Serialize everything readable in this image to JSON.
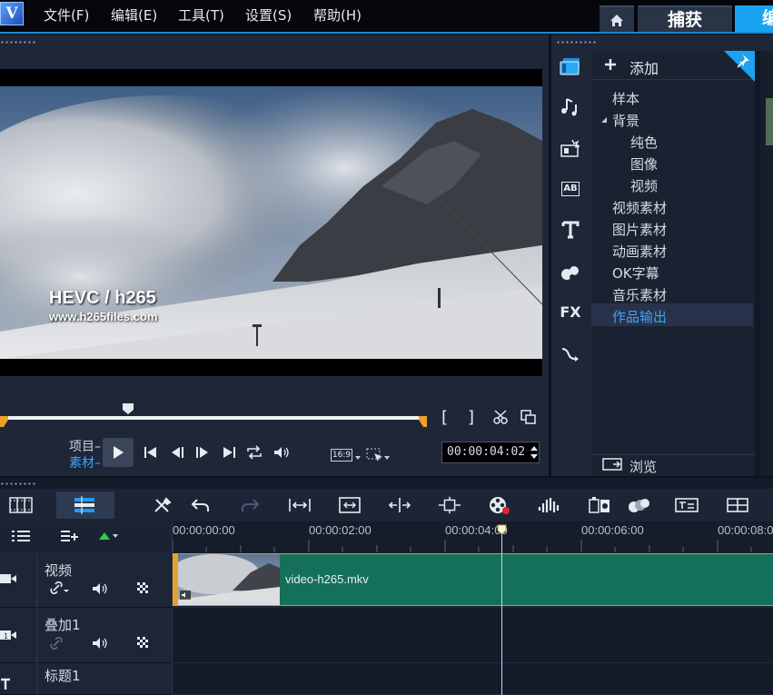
{
  "app": {
    "logo_letter": "V"
  },
  "menu": {
    "items": [
      "文件(F)",
      "编辑(E)",
      "工具(T)",
      "设置(S)",
      "帮助(H)"
    ]
  },
  "workspace_tabs": {
    "capture": "捕获",
    "edit": "编"
  },
  "preview": {
    "overlay_title": "HEVC / h265",
    "overlay_url": "www.h265files.com",
    "mode_project": "项目",
    "mode_clip": "素材",
    "aspect_ratio": "16:9",
    "timecode": "00:00:04:02",
    "in_bracket": "[",
    "out_bracket": "]"
  },
  "library": {
    "add_label": "添加",
    "items": [
      {
        "label": "样本",
        "level": 0
      },
      {
        "label": "背景",
        "level": 0,
        "expanded": true
      },
      {
        "label": "纯色",
        "level": 1
      },
      {
        "label": "图像",
        "level": 1
      },
      {
        "label": "视频",
        "level": 1
      },
      {
        "label": "视频素材",
        "level": 0
      },
      {
        "label": "图片素材",
        "level": 0
      },
      {
        "label": "动画素材",
        "level": 0
      },
      {
        "label": "OK字幕",
        "level": 0
      },
      {
        "label": "音乐素材",
        "level": 0
      },
      {
        "label": "作品输出",
        "level": 0,
        "selected": true
      }
    ],
    "browse_label": "浏览",
    "sidebar_icons": [
      "media-icon",
      "music-icon",
      "transition-icon",
      "title-ab-icon",
      "text-t-icon",
      "graphics-icon",
      "fx-icon",
      "path-icon"
    ],
    "fx_label": "FX",
    "ab_label": "AB"
  },
  "timeline": {
    "ruler_labels": [
      "00:00:00:00",
      "00:00:02:00",
      "00:00:04:00",
      "00:00:06:00",
      "00:00:08:0"
    ],
    "tracks": [
      {
        "name": "视频"
      },
      {
        "name": "叠加1"
      },
      {
        "name": "标题1"
      }
    ],
    "clip_name": "video-h265.mkv"
  },
  "colors": {
    "accent": "#18a3f0",
    "clip_green": "#157059",
    "clip_border": "#d79a2c",
    "selected_text": "#39a6ff"
  }
}
